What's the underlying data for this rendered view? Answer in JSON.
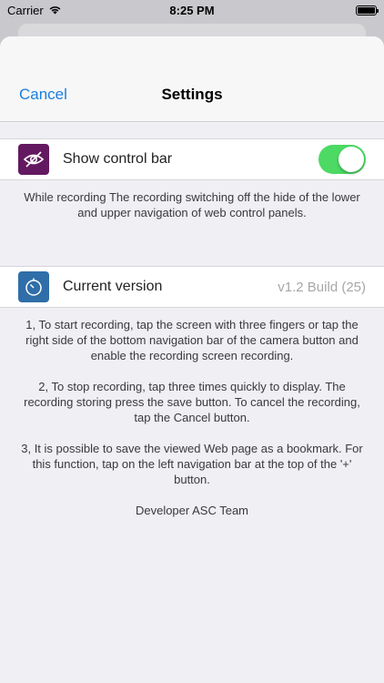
{
  "status_bar": {
    "carrier": "Carrier",
    "time": "8:25 PM"
  },
  "nav": {
    "cancel_label": "Cancel",
    "title": "Settings"
  },
  "control_bar": {
    "label": "Show control bar",
    "toggle_on": true,
    "description": "While recording The recording switching off the hide of the lower and upper navigation of web control panels."
  },
  "version": {
    "label": "Current version",
    "value": "v1.2 Build (25)"
  },
  "instructions": [
    "1, To start recording, tap the screen with three fingers or tap the right side of the bottom navigation bar of the camera button and enable the recording screen recording.",
    "2, To stop recording, tap three times quickly to display. The recording storing press the save button. To cancel the recording, tap the Cancel button.",
    "3, It is possible to save the viewed Web page as a bookmark. For this function, tap on the left navigation bar at the top of the '+' button."
  ],
  "developer": "Developer ASC Team",
  "colors": {
    "accent": "#1a7fe0",
    "toggle_on": "#4cd964",
    "control_icon_bg": "#63195f",
    "version_icon_bg": "#2f6ea8"
  },
  "icons": {
    "control_bar": "eye-slash-icon",
    "version": "timer-icon",
    "wifi": "wifi-icon",
    "battery": "battery-icon"
  }
}
